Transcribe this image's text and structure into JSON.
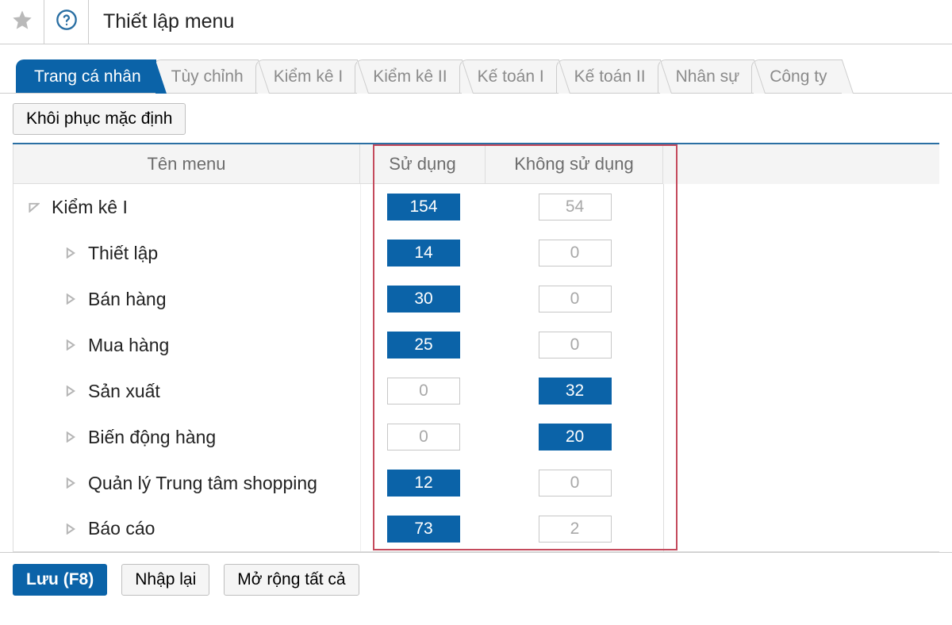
{
  "header": {
    "title": "Thiết lập menu"
  },
  "tabs": [
    {
      "label": "Trang cá nhân",
      "active": true
    },
    {
      "label": "Tùy chỉnh"
    },
    {
      "label": "Kiểm kê I"
    },
    {
      "label": "Kiểm kê II"
    },
    {
      "label": "Kế toán I"
    },
    {
      "label": "Kế toán II"
    },
    {
      "label": "Nhân sự"
    },
    {
      "label": "Công ty"
    }
  ],
  "toolbar": {
    "restore_label": "Khôi phục mặc định"
  },
  "table": {
    "columns": {
      "name": "Tên menu",
      "use": "Sử dụng",
      "nouse": "Không sử dụng"
    },
    "rows": [
      {
        "name": "Kiểm kê I",
        "use": "154",
        "use_on": true,
        "nouse": "54",
        "nouse_on": false,
        "level": 0,
        "expanded": true
      },
      {
        "name": "Thiết lập",
        "use": "14",
        "use_on": true,
        "nouse": "0",
        "nouse_on": false,
        "level": 1
      },
      {
        "name": "Bán hàng",
        "use": "30",
        "use_on": true,
        "nouse": "0",
        "nouse_on": false,
        "level": 1
      },
      {
        "name": "Mua hàng",
        "use": "25",
        "use_on": true,
        "nouse": "0",
        "nouse_on": false,
        "level": 1
      },
      {
        "name": "Sản xuất",
        "use": "0",
        "use_on": false,
        "nouse": "32",
        "nouse_on": true,
        "level": 1
      },
      {
        "name": "Biến động hàng",
        "use": "0",
        "use_on": false,
        "nouse": "20",
        "nouse_on": true,
        "level": 1
      },
      {
        "name": "Quản lý Trung tâm shopping",
        "use": "12",
        "use_on": true,
        "nouse": "0",
        "nouse_on": false,
        "level": 1
      },
      {
        "name": "Báo cáo",
        "use": "73",
        "use_on": true,
        "nouse": "2",
        "nouse_on": false,
        "level": 1
      }
    ]
  },
  "footer": {
    "save_label": "Lưu (F8)",
    "reload_label": "Nhập lại",
    "expand_label": "Mở rộng tất cả"
  }
}
